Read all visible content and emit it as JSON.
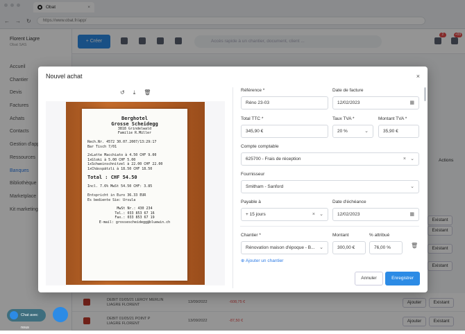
{
  "browser": {
    "tab_title": "Obat",
    "url": "https://www.obat.fr/app/"
  },
  "app": {
    "user_name": "Florent Liagre",
    "user_sub": "Obat SAS",
    "create_button": "+ Créer",
    "search_placeholder": "Accès rapide à un chantier, document, client ...",
    "notif_count": "2",
    "badge_count": "+99",
    "sidebar": [
      "Accueil",
      "Chantier",
      "Devis",
      "Factures",
      "Achats",
      "Contacts",
      "Gestion d'app",
      "Ressources",
      "Banques",
      "Bibliothèque",
      "Marketplace",
      "Kit marketing"
    ],
    "active_item": "Banques",
    "rows": [
      {
        "desc1": "DEBIT 01/05/21 LEROY MERLIN",
        "desc2": "LIAGRE FLORENT",
        "date": "13/09/2022",
        "amount": "-608,75 €",
        "btn1": "Ajouter",
        "btn2": "Existant"
      },
      {
        "desc1": "DEBIT 01/05/21 POINT P",
        "desc2": "LIAGRE FLORENT",
        "date": "13/09/2022",
        "amount": "-87,50 €",
        "btn1": "Ajouter",
        "btn2": "Existant"
      }
    ],
    "side_existant": "Existant",
    "actions_header": "Actions",
    "fab_label": "Chat avec nous"
  },
  "modal": {
    "title": "Nouvel achat",
    "close": "×",
    "fields": {
      "reference_label": "Référence *",
      "reference_value": "Réno 23-03",
      "invoice_date_label": "Date de facture",
      "invoice_date_value": "12/02/2023",
      "total_label": "Total TTC *",
      "total_value": "345,90 €",
      "vat_rate_label": "Taux TVA *",
      "vat_rate_value": "20 %",
      "vat_amount_label": "Montant TVA *",
      "vat_amount_value": "35,90 €",
      "account_label": "Compte comptable",
      "account_value": "625700 - Frais de réception",
      "supplier_label": "Fournisseur",
      "supplier_value": "Smitham - Sanford",
      "payable_label": "Payable à",
      "payable_value": "+ 15 jours",
      "due_label": "Date d'échéance",
      "due_value": "12/02/2023",
      "site_label": "Chantier *",
      "site_value": "Rénovation maison d'époque - B...",
      "amount_label": "Montant",
      "amount_value": "300,00 €",
      "percent_label": "% attribué",
      "percent_value": "76,00 %"
    },
    "add_site": "Ajouter un chantier",
    "cancel": "Annuler",
    "save": "Enregistrer"
  },
  "receipt": [
    "Berghotel",
    "Grosse Scheidegg",
    "3818 Grindelwald",
    "Familie R.Müller",
    "Rech.Nr. 4572      30.07.2007/13:29:17",
    "Bar                     Tisch  7/01",
    "2xLatte Macchiato  à  4.50 CHF    9.00",
    "1xGloki            à  5.00 CHF    5.00",
    "1xSchweinschnitzel à 22.00 CHF   22.00",
    "1xChässpätzli      à 18.50 CHF   18.50",
    "Total :    CHF     54.50",
    "Incl. 7.6% MwSt   54.50 CHF:   3.85",
    "Entspricht in Euro   36.33  EUR",
    "Es bediente Sie: Ursula",
    "MwSt Nr.: 430 234",
    "Tel.: 033 853 67 16",
    "Fax.: 033 853 67 19",
    "E-mail: grossescheidegg@bluewin.ch"
  ]
}
